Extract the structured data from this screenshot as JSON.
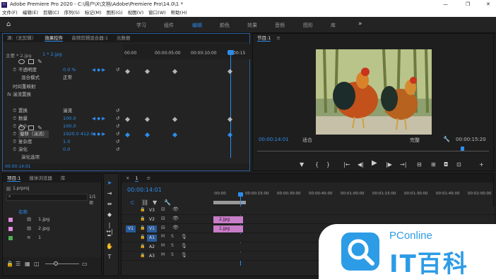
{
  "titlebar": {
    "title": "Adobe Premiere Pro 2020 - C:\\用户\\X\\文档\\Adobe\\Premiere Pro\\14.0\\1 *",
    "min": "—",
    "max": "❐",
    "close": "✕"
  },
  "menu": [
    "文件(F)",
    "编辑(E)",
    "剪辑(C)",
    "序列(S)",
    "标记(M)",
    "图形(G)",
    "视图(V)",
    "窗口(W)",
    "帮助(H)"
  ],
  "workspaces": [
    "学习",
    "组件",
    "编辑",
    "颜色",
    "效果",
    "音频",
    "图形",
    "库"
  ],
  "active_workspace": "编辑",
  "effects_panel": {
    "tabs": [
      "源:（无剪辑）",
      "效果控件",
      "音频剪辑混合器:1",
      "元数据"
    ],
    "master": "主要 * 2.jpg",
    "clip": "1 * 2.jpg",
    "ruler": [
      "00:00",
      "00:00:05:00",
      "00:00:10:00",
      "00:15"
    ],
    "rows": [
      {
        "label": "不透明度",
        "value": "0.0 %"
      },
      {
        "label": "混合模式",
        "value": "正常"
      },
      {
        "label": "时间重映射",
        "value": ""
      },
      {
        "label": "湍流置换",
        "value": ""
      },
      {
        "label": "置换",
        "value": "湍流"
      },
      {
        "label": "数量",
        "value": "100.0"
      },
      {
        "label": "大小",
        "value": "100.0"
      },
      {
        "label": "偏移（湍流）",
        "value": "1920.0    412.0"
      },
      {
        "label": "复杂度",
        "value": "1.0"
      },
      {
        "label": "演化",
        "value": "0.0"
      },
      {
        "label": "演化选项",
        "value": ""
      }
    ],
    "fx": "fx",
    "time": "00:00:14:01"
  },
  "program": {
    "title": "节目:1",
    "time": "00:00:14:01",
    "fit": "适合",
    "quality": "完整",
    "duration": "00:00:15:20",
    "controls": [
      "▼",
      "{",
      "}",
      "|←",
      "◀|",
      "▶",
      "|▶",
      "→|",
      "⊟",
      "⊞",
      "◘",
      "⊡",
      "+"
    ]
  },
  "project": {
    "tabs": [
      "项目:1",
      "媒体浏览器",
      "库"
    ],
    "file": "1.prproj",
    "count": "1/1 项",
    "header": "名称",
    "items": [
      "1.jpg",
      "2.jpg",
      "1"
    ],
    "item_colors": [
      "#e08ae0",
      "#e08ae0",
      "#4caf50"
    ]
  },
  "timeline": {
    "tab": "1",
    "time": "00:00:14:01",
    "ruler": [
      ":00:00",
      "00:00:15:00",
      "00:00:30:00",
      "00:00:45:00",
      "00:01:00:00",
      "00:01:15:00",
      "00:01:30:00",
      "00:01:45:00",
      "00:02:00:00"
    ],
    "video_tracks": [
      "V3",
      "V2",
      "V1"
    ],
    "audio_tracks": [
      "A1",
      "A2",
      "A3"
    ],
    "source": "V1",
    "clips": [
      {
        "name": "2.jpg",
        "track": "V2"
      },
      {
        "name": "1.jpg",
        "track": "V1"
      }
    ]
  },
  "watermark": {
    "brand": "PConline",
    "text": "IT百科"
  }
}
